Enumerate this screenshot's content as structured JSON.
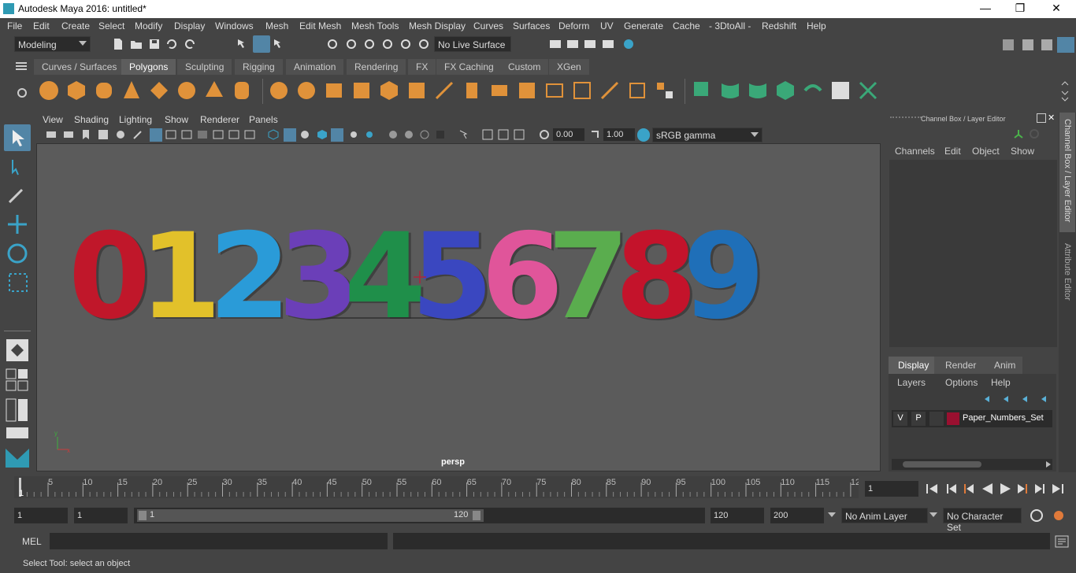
{
  "window": {
    "title": "Autodesk Maya 2016: untitled*"
  },
  "menubar": [
    "File",
    "Edit",
    "Create",
    "Select",
    "Modify",
    "Display",
    "Windows",
    "Mesh",
    "Edit Mesh",
    "Mesh Tools",
    "Mesh Display",
    "Curves",
    "Surfaces",
    "Deform",
    "UV",
    "Generate",
    "Cache",
    "- 3DtoAll -",
    "Redshift",
    "Help"
  ],
  "statusline": {
    "mode": "Modeling",
    "live_surface": "No Live Surface"
  },
  "shelf_tabs": [
    "Curves / Surfaces",
    "Polygons",
    "Sculpting",
    "Rigging",
    "Animation",
    "Rendering",
    "FX",
    "FX Caching",
    "Custom",
    "XGen"
  ],
  "shelf_active": "Polygons",
  "panel_menu": [
    "View",
    "Shading",
    "Lighting",
    "Show",
    "Renderer",
    "Panels"
  ],
  "panel_toolbar": {
    "exposure": "0.00",
    "gamma": "1.00",
    "color_space": "sRGB gamma"
  },
  "viewport": {
    "camera": "persp",
    "digits": [
      {
        "char": "0",
        "color": "#c0172a"
      },
      {
        "char": "1",
        "color": "#e2c12a"
      },
      {
        "char": "2",
        "color": "#2a9bd8"
      },
      {
        "char": "3",
        "color": "#6b3fb8"
      },
      {
        "char": "4",
        "color": "#1f8f4a"
      },
      {
        "char": "5",
        "color": "#3a47c0"
      },
      {
        "char": "6",
        "color": "#e0559a"
      },
      {
        "char": "7",
        "color": "#5aad4e"
      },
      {
        "char": "8",
        "color": "#c4132b"
      },
      {
        "char": "9",
        "color": "#1f6fb8"
      }
    ]
  },
  "channel_box": {
    "title": "Channel Box / Layer Editor",
    "menu": [
      "Channels",
      "Edit",
      "Object",
      "Show"
    ]
  },
  "side_tabs": [
    "Channel Box / Layer Editor",
    "Attribute Editor"
  ],
  "layer_editor": {
    "tabs": [
      "Display",
      "Render",
      "Anim"
    ],
    "active_tab": "Display",
    "menu": [
      "Layers",
      "Options",
      "Help"
    ],
    "layers": [
      {
        "v": "V",
        "p": "P",
        "color": "#9a1030",
        "name": "Paper_Numbers_Set"
      }
    ]
  },
  "timeslider": {
    "ticks": [
      "5",
      "10",
      "15",
      "20",
      "25",
      "30",
      "35",
      "40",
      "45",
      "50",
      "55",
      "60",
      "65",
      "70",
      "75",
      "80",
      "85",
      "90",
      "95",
      "100",
      "105",
      "110",
      "115",
      "12"
    ],
    "first_label": "1",
    "current_frame": "1"
  },
  "range": {
    "start": "1",
    "current": "1",
    "slider_start": "1",
    "slider_end": "120",
    "end": "120",
    "max": "200",
    "anim_layer": "No Anim Layer",
    "char_set": "No Character Set"
  },
  "cmdline": {
    "label": "MEL"
  },
  "helpline": {
    "text": "Select Tool: select an object"
  }
}
